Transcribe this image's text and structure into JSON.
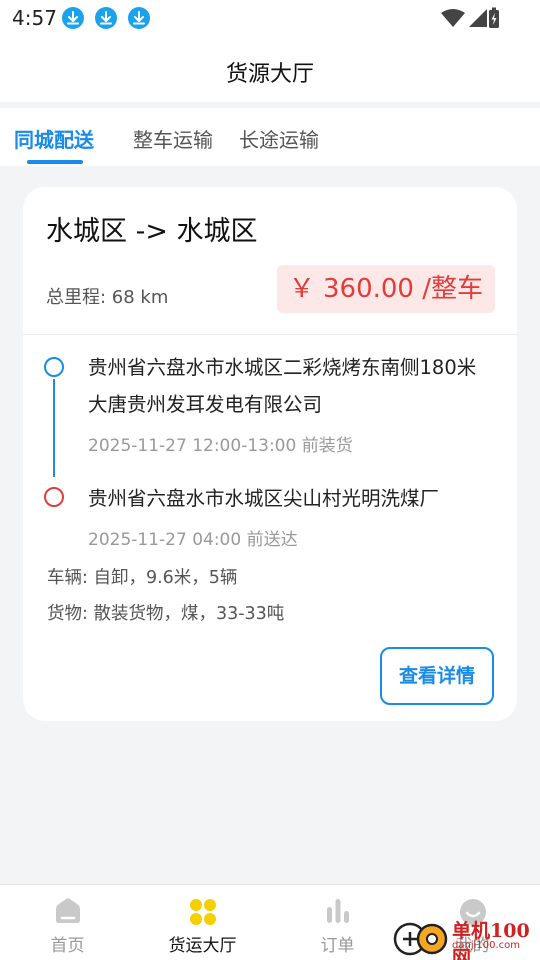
{
  "status_bar": {
    "time": "4:57"
  },
  "header": {
    "title": "货源大厅"
  },
  "tabs": [
    {
      "label": "同城配送",
      "active": true
    },
    {
      "label": "整车运输",
      "active": false
    },
    {
      "label": "长途运输",
      "active": false
    }
  ],
  "card": {
    "route": "水城区 -> 水城区",
    "distance": "总里程: 68 km",
    "price": "￥ 360.00 /整车",
    "start": {
      "address": "贵州省六盘水市水城区二彩烧烤东南侧180米大唐贵州发耳发电有限公司",
      "time": "2025-11-27 12:00-13:00 前装货"
    },
    "end": {
      "address": "贵州省六盘水市水城区尖山村光明洗煤厂",
      "time": "2025-11-27 04:00 前送达"
    },
    "vehicle": "车辆: 自卸，9.6米，5辆",
    "cargo": "货物: 散装货物，煤，33-33吨",
    "detail_button": "查看详情"
  },
  "bottom_nav": [
    {
      "label": "首页",
      "icon": "home-icon"
    },
    {
      "label": "货运大厅",
      "icon": "grid-icon",
      "active": true
    },
    {
      "label": "订单",
      "icon": "bar-chart-icon"
    },
    {
      "label": "我的",
      "icon": "profile-icon"
    }
  ],
  "watermark": {
    "text": "单机100网",
    "url": "danji100.com"
  },
  "colors": {
    "accent": "#1a8be6",
    "price": "#e23c3c",
    "price_bg": "#fde8e8",
    "active_nav": "#f5d000",
    "download_badge": "#1aa2ec"
  }
}
